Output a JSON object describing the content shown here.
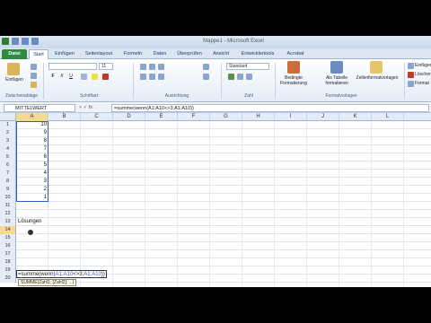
{
  "window": {
    "title": "Mappe1 - Microsoft Excel"
  },
  "ribbon_tabs": [
    "Datei",
    "Start",
    "Einfügen",
    "Seitenlayout",
    "Formeln",
    "Daten",
    "Überprüfen",
    "Ansicht",
    "Entwicklertools",
    "Acrobat"
  ],
  "active_tab": "Start",
  "ribbon": {
    "paste_label": "Einfügen",
    "clipboard_group": "Zwischenablage",
    "font_size": "11",
    "font_group": "Schriftart",
    "alignment_group": "Ausrichtung",
    "number_format": "Standard",
    "number_group": "Zahl",
    "conditional_format": "Bedingte Formatierung",
    "format_as_table": "Als Tabelle formatieren",
    "cell_styles": "Zellenformatvorlagen",
    "styles_group": "Formatvorlagen",
    "insert_cells": "Einfügen",
    "delete_cells": "Löschen",
    "format_cells": "Format"
  },
  "formula_bar": {
    "name_box": "MITTELWERT",
    "fx_label": "× ✓ fx",
    "formula": "=summe(wenn(A1:A10<>3;A1:A10))"
  },
  "columns": [
    "A",
    "B",
    "C",
    "D",
    "E",
    "F",
    "G",
    "H",
    "I",
    "J",
    "K",
    "L"
  ],
  "rows": [
    "1",
    "2",
    "3",
    "4",
    "5",
    "6",
    "7",
    "8",
    "9",
    "10",
    "11",
    "12",
    "13",
    "14",
    "15",
    "16",
    "17",
    "18",
    "19",
    "20"
  ],
  "column_a_values": [
    "10",
    "9",
    "8",
    "7",
    "6",
    "5",
    "4",
    "3",
    "2",
    "1"
  ],
  "label_a13": "Lösungen",
  "edit_cell": {
    "prefix": "=summe(wenn(",
    "ref1": "A1:A10",
    "mid": "<>3;",
    "ref2": "A1:A10",
    "suffix": "))"
  },
  "tooltip": "SUMME(Zahl1; [Zahl2]; ...)",
  "colors": {
    "file_tab": "#2e8b3e",
    "selection_border": "#2f59c6",
    "header_highlight": "#f7d891"
  }
}
